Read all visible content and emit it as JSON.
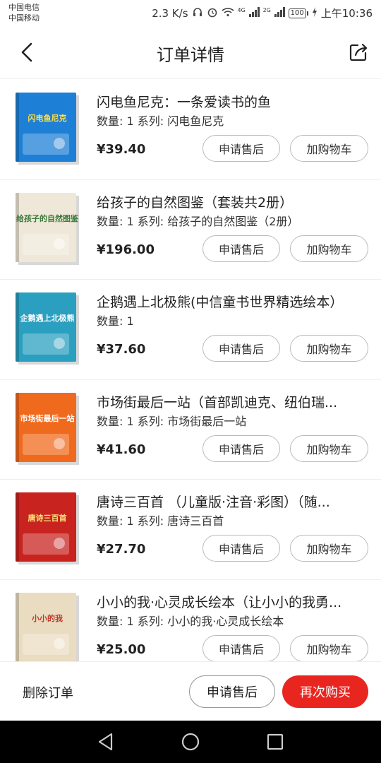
{
  "status_bar": {
    "carrier_1": "中国电信",
    "carrier_2": "中国移动",
    "speed": "2.3 K/s",
    "net_1": "4G",
    "net_2": "2G",
    "battery": "100",
    "time": "上午10:36"
  },
  "header": {
    "title": "订单详情",
    "back_icon": "chevron-left-icon",
    "share_icon": "share-icon"
  },
  "items": [
    {
      "title": "闪电鱼尼克：一条爱读书的鱼",
      "meta": "数量: 1 系列: 闪电鱼尼克",
      "price": "¥39.40",
      "cover_color": "#1e7fd6",
      "cover_text": "闪电鱼尼克",
      "cover_text_color": "#ffe14a"
    },
    {
      "title": "给孩子的自然图鉴（套装共2册）",
      "meta": "数量: 1 系列: 给孩子的自然图鉴（2册）",
      "price": "¥196.00",
      "cover_color": "#efe8d8",
      "cover_text": "给孩子的自然图鉴",
      "cover_text_color": "#3a7a3a"
    },
    {
      "title": "企鹅遇上北极熊(中信童书世界精选绘本）",
      "meta": "数量: 1",
      "price": "¥37.60",
      "cover_color": "#2a9fc0",
      "cover_text": "企鹅遇上北极熊",
      "cover_text_color": "#ffffff"
    },
    {
      "title": "市场街最后一站（首部凯迪克、纽伯瑞...",
      "meta": "数量: 1 系列: 市场街最后一站",
      "price": "¥41.60",
      "cover_color": "#f06a1e",
      "cover_text": "市场街最后一站",
      "cover_text_color": "#ffffff"
    },
    {
      "title": "唐诗三百首 （儿童版·注音·彩图）（随...",
      "meta": "数量: 1 系列: 唐诗三百首",
      "price": "¥27.70",
      "cover_color": "#c8231f",
      "cover_text": "唐诗三百首",
      "cover_text_color": "#ffe07a"
    },
    {
      "title": "小小的我·心灵成长绘本（让小小的我勇...",
      "meta": "数量: 1 系列: 小小的我·心灵成长绘本",
      "price": "¥25.00",
      "cover_color": "#eadcc0",
      "cover_text": "小小的我",
      "cover_text_color": "#c0392b"
    }
  ],
  "item_buttons": {
    "after_sale": "申请售后",
    "add_cart": "加购物车"
  },
  "action_bar": {
    "delete": "删除订单",
    "after_sale": "申请售后",
    "rebuy": "再次购买",
    "accent_color": "#e8261f"
  },
  "system_nav": {
    "back_icon": "triangle-back-icon",
    "home_icon": "circle-home-icon",
    "recents_icon": "square-recents-icon"
  }
}
